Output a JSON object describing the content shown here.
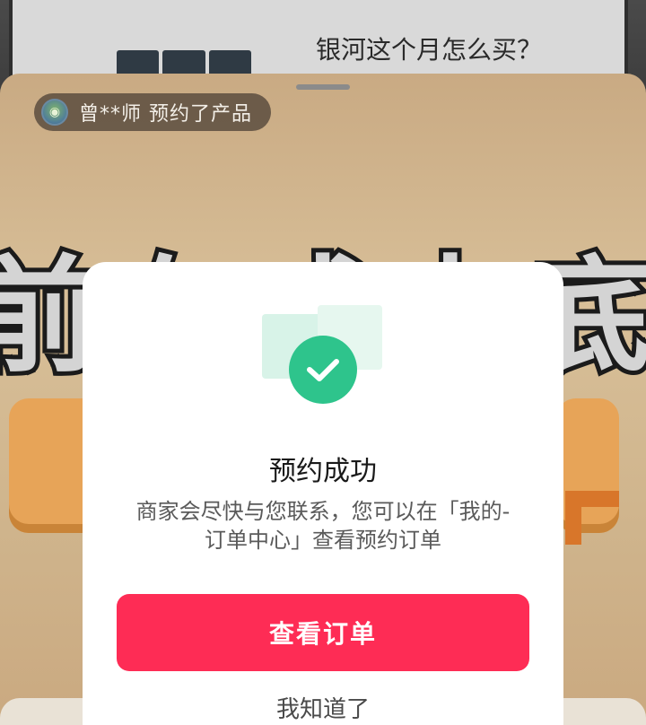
{
  "background": {
    "question_text": "银河这个月怎么买？",
    "big_word_text": "前有成末底价"
  },
  "notice": {
    "text": "曾**师 预约了产品",
    "avatar_icon": "user-avatar-icon"
  },
  "modal": {
    "icon": "check-icon",
    "accent_color": "#2ec48c",
    "title": "预约成功",
    "description": "商家会尽快与您联系，您可以在「我的-订单中心」查看预约订单",
    "primary_button": "查看订单",
    "primary_color": "#fe2c55",
    "secondary_button": "我知道了"
  }
}
